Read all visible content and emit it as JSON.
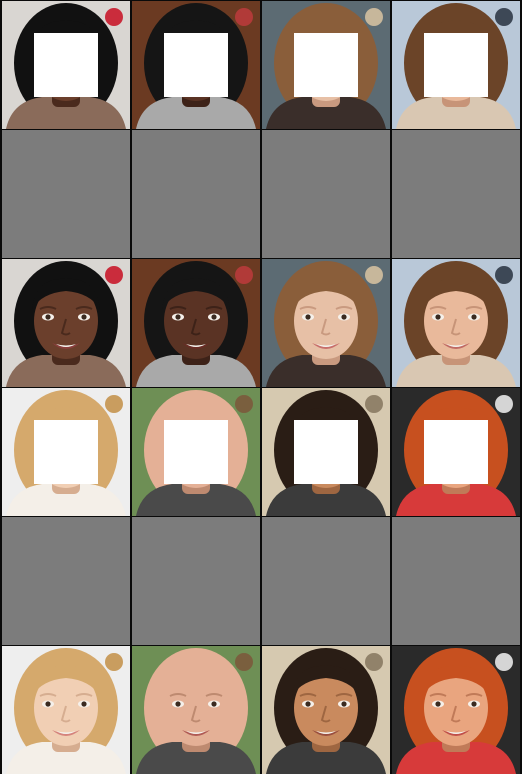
{
  "grid": {
    "columns": 4,
    "rows": 6,
    "colors": {
      "background": "#000000",
      "placeholder": "#7c7c7c",
      "mask": "#ffffff"
    }
  },
  "faces": [
    {
      "id": "f1",
      "skin": "#6b3f2c",
      "skin_shadow": "#4a2a1d",
      "hair": "#111111",
      "bg": "#d9d6d2",
      "shirt": "#8a6b5a",
      "accent": "#c8192b",
      "lip": "#8a3e3c"
    },
    {
      "id": "f2",
      "skin": "#5a3324",
      "skin_shadow": "#3d2218",
      "hair": "#151515",
      "bg": "#6b3a22",
      "shirt": "#a9a9a9",
      "accent": "#b93b3b",
      "lip": "#6a2c25"
    },
    {
      "id": "f3",
      "skin": "#e7c0a6",
      "skin_shadow": "#c99a80",
      "hair": "#8a5e3a",
      "bg": "#5c6b73",
      "shirt": "#3a2e2a",
      "accent": "#d3c0a0",
      "lip": "#c86f6b"
    },
    {
      "id": "f4",
      "skin": "#e9b99b",
      "skin_shadow": "#c79478",
      "hair": "#6b4428",
      "bg": "#b9c8d8",
      "shirt": "#d9c7b2",
      "accent": "#303a48",
      "lip": "#c06a64"
    },
    {
      "id": "f5",
      "skin": "#f1cfb4",
      "skin_shadow": "#d6ad90",
      "hair": "#d5a96c",
      "bg": "#eeeeee",
      "shirt": "#f4efe8",
      "accent": "#c4944f",
      "lip": "#d5847d"
    },
    {
      "id": "f6",
      "skin": "#e4b096",
      "skin_shadow": "#be8a70",
      "hair": "#e4b096",
      "bg": "#6e8f55",
      "shirt": "#4a4a4a",
      "accent": "#7b5a3c",
      "lip": "#b05b55"
    },
    {
      "id": "f7",
      "skin": "#c98a5e",
      "skin_shadow": "#9e6641",
      "hair": "#2a1d15",
      "bg": "#d6c9b0",
      "shirt": "#3b3b3b",
      "accent": "#8a7a63",
      "lip": "#9a4f3f"
    },
    {
      "id": "f8",
      "skin": "#e9a57f",
      "skin_shadow": "#c07a58",
      "hair": "#c7501f",
      "bg": "#2a2a2a",
      "shirt": "#d73a3a",
      "accent": "#e8e8e8",
      "lip": "#c0504a"
    }
  ],
  "layout_rows": [
    {
      "type": "masked",
      "faces": [
        "f1",
        "f2",
        "f3",
        "f4"
      ]
    },
    {
      "type": "blank"
    },
    {
      "type": "full",
      "faces": [
        "f1",
        "f2",
        "f3",
        "f4"
      ]
    },
    {
      "type": "masked",
      "faces": [
        "f5",
        "f6",
        "f7",
        "f8"
      ]
    },
    {
      "type": "blank"
    },
    {
      "type": "full",
      "faces": [
        "f5",
        "f6",
        "f7",
        "f8"
      ]
    }
  ]
}
